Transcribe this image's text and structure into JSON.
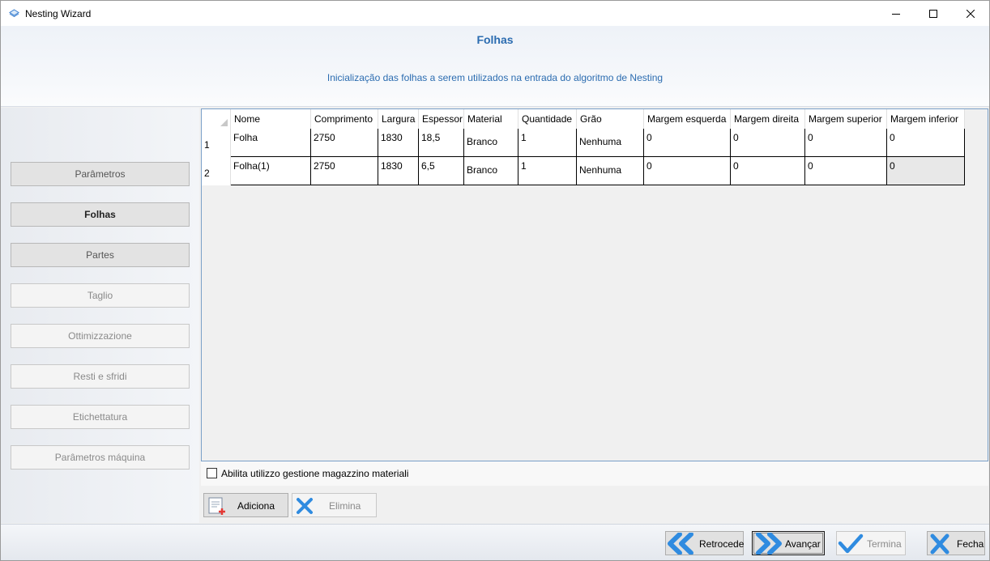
{
  "window": {
    "title": "Nesting Wizard"
  },
  "header": {
    "title": "Folhas",
    "subtitle": "Inicialização das folhas a serem utilizados na entrada do algoritmo de Nesting"
  },
  "sidebar": {
    "items": [
      {
        "label": "Parâmetros",
        "state": "enabled"
      },
      {
        "label": "Folhas",
        "state": "active"
      },
      {
        "label": "Partes",
        "state": "enabled"
      },
      {
        "label": "Taglio",
        "state": "disabled"
      },
      {
        "label": "Ottimizzazione",
        "state": "disabled"
      },
      {
        "label": "Resti e sfridi",
        "state": "disabled"
      },
      {
        "label": "Etichettatura",
        "state": "disabled"
      },
      {
        "label": "Parâmetros máquina",
        "state": "disabled"
      }
    ]
  },
  "grid": {
    "columns": [
      "Nome",
      "Comprimento",
      "Largura",
      "Espessor",
      "Material",
      "Quantidade",
      "Grão",
      "Margem esquerda",
      "Margem direita",
      "Margem superior",
      "Margem inferior"
    ],
    "rows": [
      {
        "index": "1",
        "cells": [
          "Folha",
          "2750",
          "1830",
          "18,5",
          "Branco",
          "1",
          "Nenhuma",
          "0",
          "0",
          "0",
          "0"
        ]
      },
      {
        "index": "2",
        "cells": [
          "Folha(1)",
          "2750",
          "1830",
          "6,5",
          "Branco",
          "1",
          "Nenhuma",
          "0",
          "0",
          "0",
          "0"
        ]
      }
    ]
  },
  "options": {
    "warehouse_label": "Abilita utilizzo gestione magazzino materiali",
    "warehouse_checked": false
  },
  "actions": {
    "add_label": "Adiciona",
    "delete_label": "Elimina"
  },
  "footer": {
    "back_label": "Retrocede",
    "next_label": "Avançar",
    "finish_label": "Termina",
    "close_label": "Fecha"
  },
  "colors": {
    "accent": "#2b6cb0",
    "icon_blue": "#2f8be0",
    "add_red": "#e53935"
  }
}
